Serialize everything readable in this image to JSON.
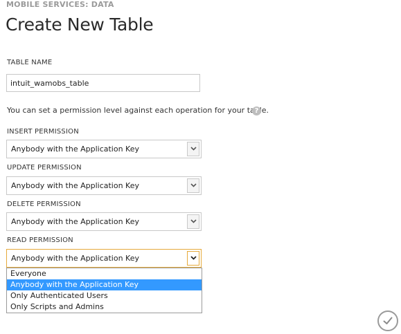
{
  "header": {
    "eyebrow": "MOBILE SERVICES: DATA",
    "title": "Create New Table"
  },
  "table_name": {
    "label": "TABLE NAME",
    "value": "intuit_wamobs_table"
  },
  "hint": "You can set a permission level against each operation for your table.",
  "permissions": {
    "insert": {
      "label": "INSERT PERMISSION",
      "value": "Anybody with the Application Key"
    },
    "update": {
      "label": "UPDATE PERMISSION",
      "value": "Anybody with the Application Key"
    },
    "delete": {
      "label": "DELETE PERMISSION",
      "value": "Anybody with the Application Key"
    },
    "read": {
      "label": "READ PERMISSION",
      "value": "Anybody with the Application Key"
    }
  },
  "dropdown": {
    "options": [
      "Everyone",
      "Anybody with the Application Key",
      "Only Authenticated Users",
      "Only Scripts and Admins"
    ],
    "selected_index": 1
  },
  "icons": {
    "help": "help-icon",
    "complete": "checkmark-icon",
    "dropdown": "chevron-down-icon"
  },
  "colors": {
    "accent_focus": "#e6a93a",
    "selection": "#3399ff"
  }
}
